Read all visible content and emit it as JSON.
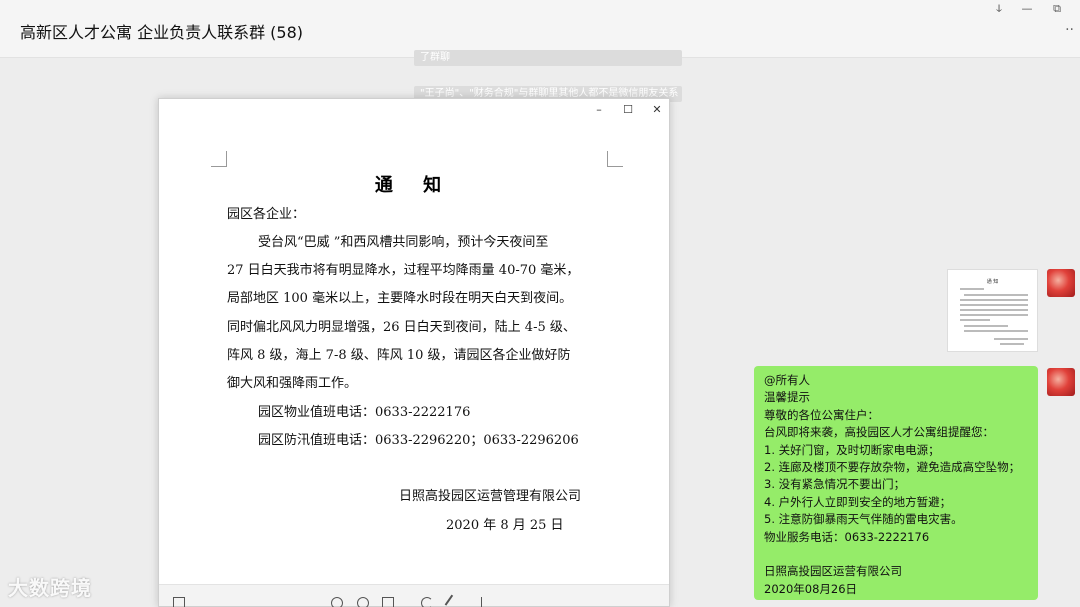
{
  "window": {
    "title": "高新区人才公寓 企业负责人联系群 (58)",
    "controls": {
      "pin": "ↆ",
      "minimize": "—",
      "restore": "⧉"
    },
    "more": "··"
  },
  "background_messages": [
    "了群聊",
    "\"王子尚\"、\"财务合规\"与群聊里其他人都不是微信朋友关系"
  ],
  "doc_viewer": {
    "controls": {
      "minimize": "–",
      "maximize": "☐",
      "close": "✕"
    },
    "notice": {
      "title": "通 知",
      "greeting": "园区各企业：",
      "lines": [
        "受台风“巴威 ”和西风槽共同影响，预计今天夜间至",
        "27 日白天我市将有明显降水，过程平均降雨量 40-70 毫米，",
        "局部地区 100 毫米以上，主要降水时段在明天白天到夜间。",
        "同时偏北风风力明显增强，26 日白天到夜间，陆上 4-5 级、",
        "阵风 8 级，海上 7-8 级、阵风 10 级，请园区各企业做好防",
        "御大风和强降雨工作。"
      ],
      "phone_duty": "园区物业值班电话：0633-2222176",
      "phone_flood": "园区防汛值班电话：0633-2296220；0633-2296206",
      "signature": "日照高投园区运营管理有限公司",
      "date": "2020 年 8 月 25 日"
    }
  },
  "chat": {
    "image_thumb_title": "通 知",
    "message_lines": [
      "@所有人",
      "温馨提示",
      "尊敬的各位公寓住户：",
      "台风即将来袭，高投园区人才公寓组提醒您：",
      "1. 关好门窗，及时切断家电电源；",
      "2. 连廊及楼顶不要存放杂物，避免造成高空坠物；",
      "3. 没有紧急情况不要出门；",
      "4. 户外行人立即到安全的地方暂避；",
      "5. 注意防御暴雨天气伴随的雷电灾害。",
      "物业服务电话：0633-2222176",
      "",
      "日照高投园区运营有限公司",
      "2020年08月26日"
    ]
  },
  "watermark": "大数跨境",
  "colors": {
    "bubble": "#95ec69",
    "chat_bg": "#ededed",
    "avatar": "#e0413a"
  }
}
